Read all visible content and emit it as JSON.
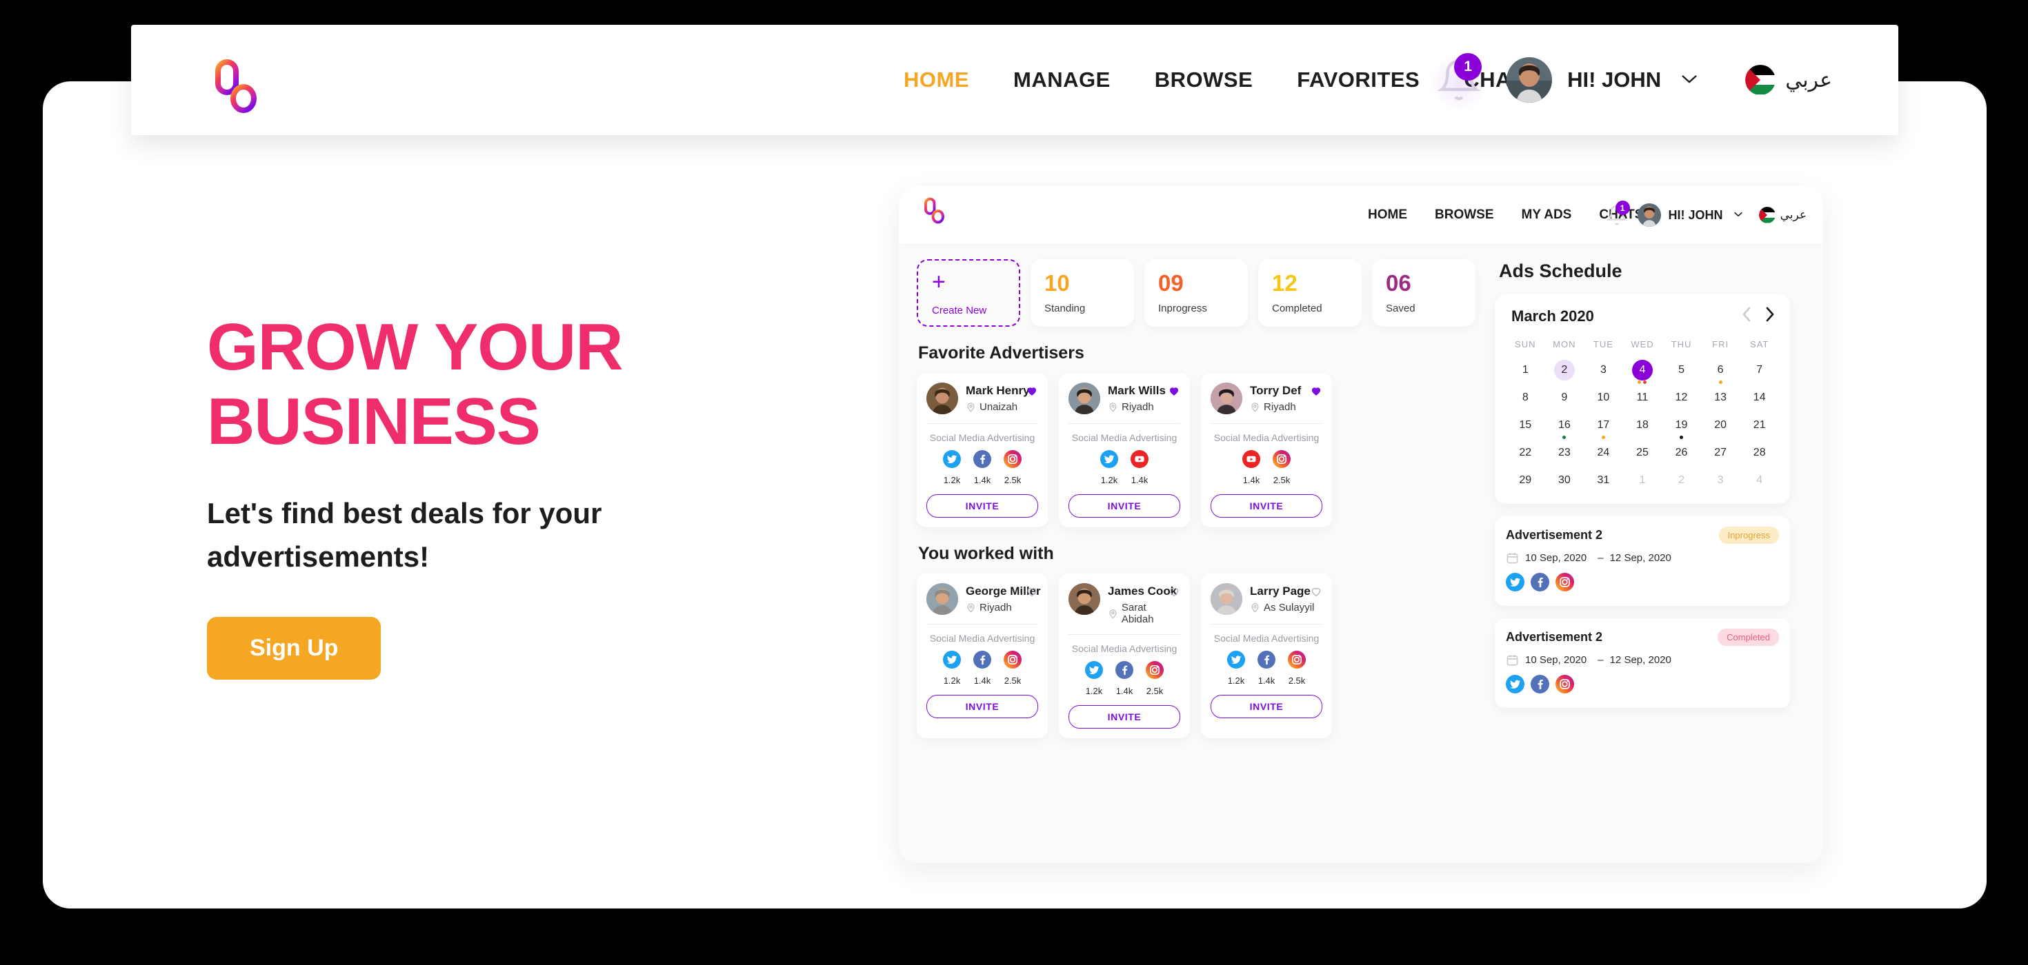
{
  "brand": {
    "logo_name": "infinity-loop-logo"
  },
  "topnav": {
    "links": [
      {
        "label": "HOME",
        "active": true
      },
      {
        "label": "MANAGE",
        "active": false
      },
      {
        "label": "BROWSE",
        "active": false
      },
      {
        "label": "FAVORITES",
        "active": false
      },
      {
        "label": "CHATS",
        "active": false
      }
    ],
    "notification_count": "1",
    "greeting": "HI! JOHN",
    "language_label": "عربي",
    "language_flag": "palestine-flag"
  },
  "hero": {
    "title_line1": "GROW YOUR",
    "title_line2": "BUSINESS",
    "subtitle": "Let's find best deals for your advertisements!",
    "cta_label": "Sign Up",
    "title_color": "#EF2D6B",
    "cta_color": "#F5A623"
  },
  "dashboard": {
    "nav": {
      "links": [
        "HOME",
        "BROWSE",
        "MY ADS",
        "CHATS"
      ],
      "notification_count": "1",
      "greeting": "HI! JOHN",
      "language_label": "عربي"
    },
    "stats": [
      {
        "type": "create",
        "plus": "+",
        "label": "Create New",
        "color": "#8B00D8"
      },
      {
        "type": "stat",
        "value": "10",
        "label": "Standing",
        "color": "#F5A623"
      },
      {
        "type": "stat",
        "value": "09",
        "label": "Inprogress",
        "color": "#F4602A"
      },
      {
        "type": "stat",
        "value": "12",
        "label": "Completed",
        "color": "#F5C518"
      },
      {
        "type": "stat",
        "value": "06",
        "label": "Saved",
        "color": "#9C2B86"
      }
    ],
    "favorites_title": "Favorite Advertisers",
    "favorites": [
      {
        "name": "Mark Henry",
        "location": "Unaizah",
        "category": "Social Media Advertising",
        "favorited": true,
        "invite_label": "INVITE",
        "socials": [
          {
            "network": "twitter",
            "count": "1.2k"
          },
          {
            "network": "facebook",
            "count": "1.4k"
          },
          {
            "network": "instagram",
            "count": "2.5k"
          }
        ]
      },
      {
        "name": "Mark Wills",
        "location": "Riyadh",
        "category": "Social Media Advertising",
        "favorited": true,
        "invite_label": "INVITE",
        "socials": [
          {
            "network": "twitter",
            "count": "1.2k"
          },
          {
            "network": "youtube",
            "count": "1.4k"
          }
        ]
      },
      {
        "name": "Torry Def",
        "location": "Riyadh",
        "category": "Social Media Advertising",
        "favorited": true,
        "invite_label": "INVITE",
        "socials": [
          {
            "network": "youtube",
            "count": "1.4k"
          },
          {
            "network": "instagram",
            "count": "2.5k"
          }
        ]
      }
    ],
    "worked_title": "You worked with",
    "worked": [
      {
        "name": "George Miller",
        "location": "Riyadh",
        "category": "Social Media Advertising",
        "favorited": false,
        "invite_label": "INVITE",
        "socials": [
          {
            "network": "twitter",
            "count": "1.2k"
          },
          {
            "network": "facebook",
            "count": "1.4k"
          },
          {
            "network": "instagram",
            "count": "2.5k"
          }
        ]
      },
      {
        "name": "James Cook",
        "location": "Sarat Abidah",
        "category": "Social Media Advertising",
        "favorited": false,
        "invite_label": "INVITE",
        "socials": [
          {
            "network": "twitter",
            "count": "1.2k"
          },
          {
            "network": "facebook",
            "count": "1.4k"
          },
          {
            "network": "instagram",
            "count": "2.5k"
          }
        ]
      },
      {
        "name": "Larry Page",
        "location": "As Sulayyil",
        "category": "Social Media Advertising",
        "favorited": false,
        "invite_label": "INVITE",
        "socials": [
          {
            "network": "twitter",
            "count": "1.2k"
          },
          {
            "network": "facebook",
            "count": "1.4k"
          },
          {
            "network": "instagram",
            "count": "2.5k"
          }
        ]
      }
    ],
    "schedule": {
      "title": "Ads Schedule",
      "month": "March 2020",
      "prev_icon": "chevron-left-icon",
      "next_icon": "chevron-right-icon",
      "dow": [
        "SUN",
        "MON",
        "TUE",
        "WED",
        "THU",
        "FRI",
        "SAT"
      ],
      "days": [
        {
          "n": "1"
        },
        {
          "n": "2",
          "state": "soft"
        },
        {
          "n": "3"
        },
        {
          "n": "4",
          "state": "sel",
          "dots": [
            "#F5A623",
            "#E8453C"
          ]
        },
        {
          "n": "5"
        },
        {
          "n": "6",
          "dots": [
            "#F5A623"
          ]
        },
        {
          "n": "7"
        },
        {
          "n": "8"
        },
        {
          "n": "9"
        },
        {
          "n": "10"
        },
        {
          "n": "11"
        },
        {
          "n": "12"
        },
        {
          "n": "13"
        },
        {
          "n": "14"
        },
        {
          "n": "15"
        },
        {
          "n": "16",
          "dots": [
            "#14803C"
          ]
        },
        {
          "n": "17",
          "dots": [
            "#F5A623"
          ]
        },
        {
          "n": "18"
        },
        {
          "n": "19",
          "dots": [
            "#141414"
          ]
        },
        {
          "n": "20"
        },
        {
          "n": "21"
        },
        {
          "n": "22"
        },
        {
          "n": "23"
        },
        {
          "n": "24"
        },
        {
          "n": "25"
        },
        {
          "n": "26"
        },
        {
          "n": "27"
        },
        {
          "n": "28"
        },
        {
          "n": "29"
        },
        {
          "n": "30"
        },
        {
          "n": "31"
        },
        {
          "n": "1",
          "state": "muted"
        },
        {
          "n": "2",
          "state": "muted"
        },
        {
          "n": "3",
          "state": "muted"
        },
        {
          "n": "4",
          "state": "muted"
        }
      ]
    },
    "ads": [
      {
        "name": "Advertisement 2",
        "status": "Inprogress",
        "status_type": "inprogress",
        "start_date": "10 Sep, 2020",
        "separator": "–",
        "end_date": "12 Sep, 2020",
        "socials": [
          "twitter",
          "facebook",
          "instagram"
        ]
      },
      {
        "name": "Advertisement 2",
        "status": "Completed",
        "status_type": "completed",
        "start_date": "10 Sep, 2020",
        "separator": "–",
        "end_date": "12 Sep, 2020",
        "socials": [
          "twitter",
          "facebook",
          "instagram"
        ]
      }
    ]
  }
}
